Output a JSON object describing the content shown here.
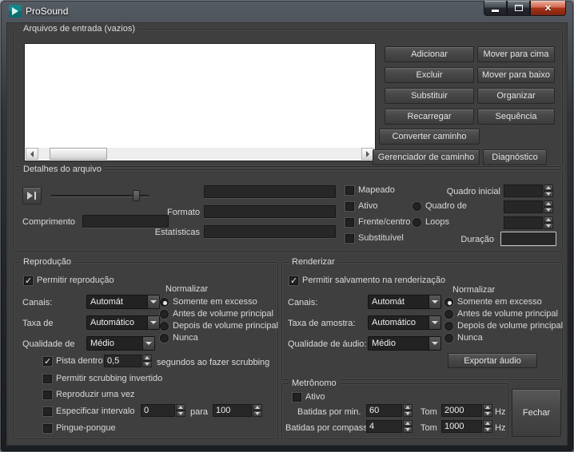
{
  "window": {
    "title": "ProSound"
  },
  "input_files": {
    "title": "Arquivos de entrada (vazios)",
    "buttons": {
      "add": "Adicionar",
      "move_up": "Mover para cima",
      "remove": "Excluir",
      "move_down": "Mover para baixo",
      "replace": "Substituir",
      "organize": "Organizar",
      "reload": "Recarregar",
      "sequence": "Sequência",
      "convert_path": "Converter caminho",
      "path_manager": "Gerenciador de caminho",
      "diagnostics": "Diagnóstico"
    }
  },
  "file_details": {
    "title": "Detalhes do arquivo",
    "length_label": "Comprimento",
    "format_label": "Formato",
    "statistics_label": "Estatísticas",
    "mapped": "Mapeado",
    "active": "Ativo",
    "front_center": "Frente/centro",
    "replaceable": "Substituível",
    "start_frame_label": "Quadro inicial",
    "frame_of_label": "Quadro de",
    "loops_label": "Loops",
    "duration_label": "Duração"
  },
  "playback": {
    "title": "Reprodução",
    "allow_label": "Permitir reprodução",
    "normalize_label": "Normalizar",
    "normalize_options": [
      "Somente em excesso",
      "Antes de volume principal",
      "Depois de volume principal",
      "Nunca"
    ],
    "channels_label": "Canais:",
    "channels_value": "Automát",
    "rate_label": "Taxa de",
    "rate_value": "Automático",
    "quality_label": "Qualidade de",
    "quality_value": "Médio",
    "scrub_label": "Pista dentro",
    "scrub_value": "0,5",
    "scrub_suffix": "segundos ao fazer scrubbing",
    "invert_scrub_label": "Permitir scrubbing invertido",
    "play_once_label": "Reproduzir uma vez",
    "interval_label": "Especificar intervalo",
    "interval_from": "0",
    "interval_to_label": "para",
    "interval_to": "100",
    "ping_pong_label": "Pingue-pongue"
  },
  "render": {
    "title": "Renderizar",
    "allow_label": "Permitir salvamento na renderização",
    "normalize_label": "Normalizar",
    "normalize_options": [
      "Somente em excesso",
      "Antes de volume principal",
      "Depois de volume principal",
      "Nunca"
    ],
    "channels_label": "Canais:",
    "channels_value": "Automát",
    "rate_label": "Taxa de amostra:",
    "rate_value": "Automático",
    "quality_label": "Qualidade de áudio:",
    "quality_value": "Médio",
    "export_label": "Exportar áudio"
  },
  "metronome": {
    "title": "Metrônomo",
    "active_label": "Ativo",
    "bpm_label": "Batidas por min.",
    "bpm_value": "60",
    "tone_label_1": "Tom",
    "tone_value_1": "2000",
    "hz_label_1": "Hz",
    "beats_label": "Batidas por compasso",
    "beats_value": "4",
    "tone_label_2": "Tom",
    "tone_value_2": "1000",
    "hz_label_2": "Hz"
  },
  "close_label": "Fechar"
}
